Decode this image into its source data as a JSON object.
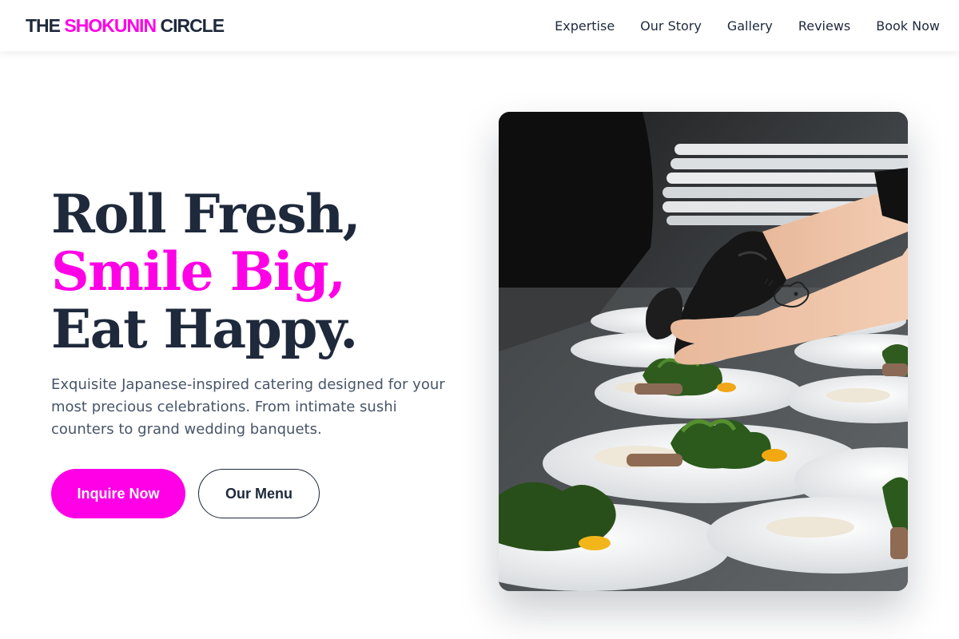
{
  "header": {
    "logo_prefix": "THE",
    "logo_accent": "SHOKUNIN",
    "logo_suffix": "CIRCLE",
    "nav": [
      "Expertise",
      "Our Story",
      "Gallery",
      "Reviews",
      "Book Now"
    ]
  },
  "hero": {
    "headline_line1": "Roll Fresh,",
    "headline_line2": "Smile Big,",
    "headline_line3": "Eat Happy.",
    "subtext": "Exquisite Japanese-inspired catering designed for your most precious celebrations. From intimate sushi counters to grand wedding banquets.",
    "primary_button": "Inquire Now",
    "secondary_button": "Our Menu"
  },
  "colors": {
    "accent": "#ff00e6",
    "text_dark": "#1e293b",
    "text_muted": "#475569"
  },
  "icons": {
    "hero_image": "chef-plating-dishes-photo"
  }
}
